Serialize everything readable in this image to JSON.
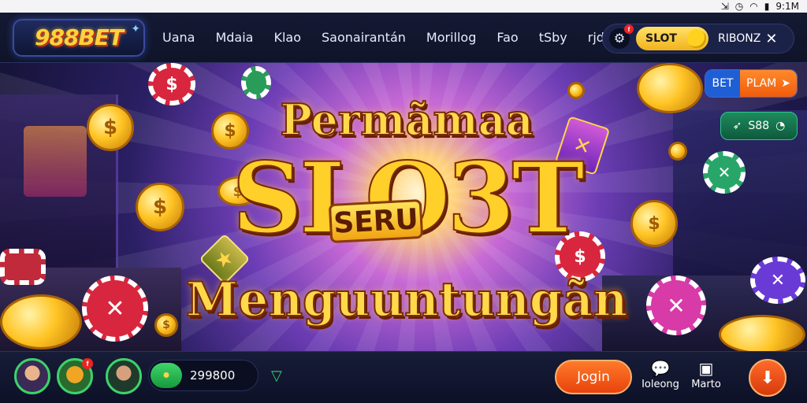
{
  "status_bar": {
    "clock": "9:1M"
  },
  "header": {
    "logo_text": "988BET",
    "nav": [
      "Uana",
      "Mdaia",
      "Klao",
      "Saonairantán",
      "Morillog",
      "Fao",
      "tSby",
      "rjdc"
    ],
    "notification_count": "f",
    "slot_pill": "SLOT",
    "region": "RIBONZ"
  },
  "hero": {
    "headline_top": "Permãmaa",
    "headline_main": "SLO3T",
    "badge": "SERU",
    "headline_bottom": "Menguuntungãn",
    "bet_button": {
      "left": "BET",
      "right": "PLAM"
    },
    "s_button": "S88"
  },
  "bottom": {
    "avatar_badge": "f",
    "balance": "299800",
    "login": "Jogin",
    "item1": "Ioleong",
    "item2": "Marto"
  },
  "colors": {
    "accent": "#ffd23a",
    "action": "#f15b0c",
    "success": "#2fd36a"
  }
}
